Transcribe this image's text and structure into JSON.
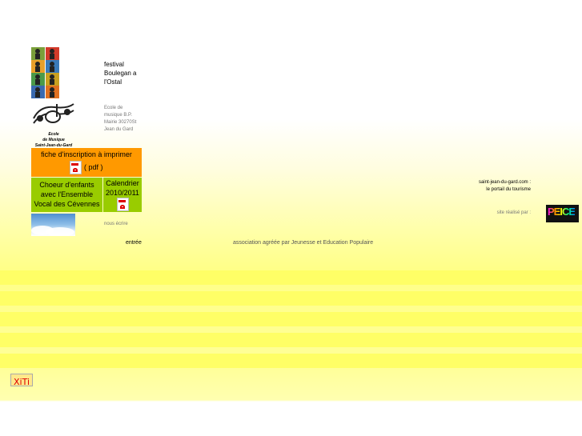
{
  "left": {
    "festival_text": "festival Boulegan a l'Ostal",
    "ecole_logo_lines": [
      "Ecole",
      "de Musique",
      "Saint-Jean-du-Gard"
    ],
    "ecole_info": "Ecole de musique B.P. Mairie 30270St Jean du Gard",
    "inscription_title": "fiche d'inscription à imprimer",
    "inscription_pdf": "( pdf )",
    "choeur_text": "Choeur d'enfants avec l'Ensemble Vocal des Cévennes",
    "calendrier_text": "Calendrier 2010/2011",
    "nous_ecrire": "nous écrire",
    "entree": "entrée"
  },
  "center": {
    "association": "association agréée par Jeunesse et Education Populaire"
  },
  "right": {
    "portal_line1": "saint-jean-du-gard.com :",
    "portal_line2": "le portail du tourisme",
    "site_realise": "site réalisé par :",
    "maker_logo_text": "PEICE"
  },
  "footer": {
    "xiti": "XiTi"
  },
  "colors": {
    "orange_cell": "#ff9900",
    "green_cell": "#99cc00",
    "band_yellow": "#ffff66"
  }
}
